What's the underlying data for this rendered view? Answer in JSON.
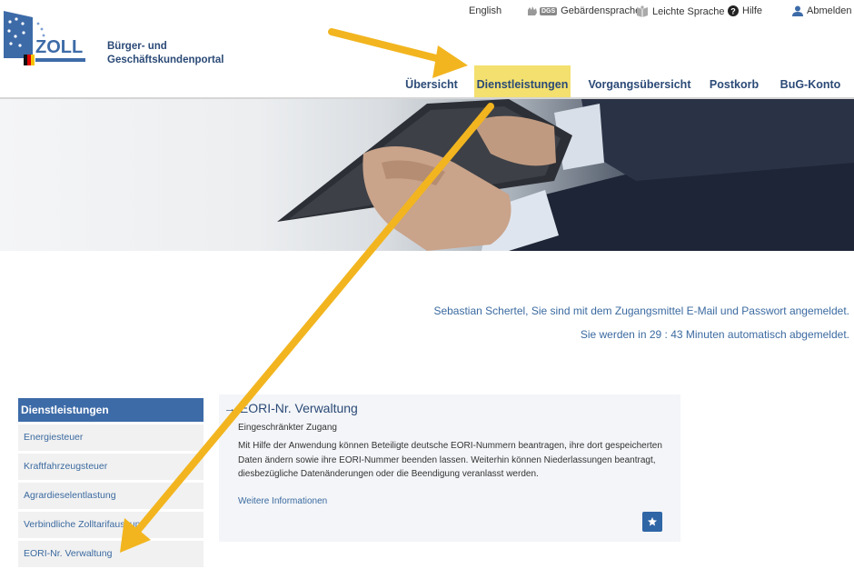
{
  "header": {
    "logo_text": "ZOLL",
    "portal_name_line1": "Bürger- und",
    "portal_name_line2": "Geschäftskundenportal"
  },
  "toplinks": {
    "english": "English",
    "sign_language_badge": "DGS",
    "sign_language": "Gebärdensprache",
    "easy_language": "Leichte Sprache",
    "help": "Hilfe",
    "logout": "Abmelden"
  },
  "nav": {
    "items": [
      "Übersicht",
      "Dienstleistungen",
      "Vorgangsübersicht",
      "Postkorb",
      "BuG-Konto"
    ],
    "active": "Dienstleistungen"
  },
  "login_info": {
    "line1": "Sebastian Schertel, Sie sind mit dem Zugangsmittel E-Mail und Passwort angemeldet.",
    "line2": "Sie werden in 29 : 43 Minuten automatisch abgemeldet."
  },
  "sidebar": {
    "title": "Dienstleistungen",
    "items": [
      "Energiesteuer",
      "Kraftfahrzeugsteuer",
      "Agrardieselentlastung",
      "Verbindliche Zolltarifauskunft",
      "EORI-Nr. Verwaltung"
    ]
  },
  "service_card": {
    "arrow": "→",
    "title": "EORI-Nr. Verwaltung",
    "subtitle": "Eingeschränkter Zugang",
    "description": "Mit Hilfe der Anwendung können Beteiligte deutsche EORI-Nummern beantragen, ihre dort gespeicherten Daten ändern sowie ihre EORI-Nummer beenden lassen. Weiterhin können Niederlassungen beantragt, diesbezügliche Datenänderungen  oder die Beendigung veranlasst werden.",
    "more_link": "Weitere Informationen"
  },
  "colors": {
    "brand_blue": "#2b4a77",
    "link_blue": "#3b6aa0",
    "sidebar_head": "#3d6ba8",
    "active_nav": "#f3e06e",
    "annotation_arrow": "#f2b51f"
  }
}
